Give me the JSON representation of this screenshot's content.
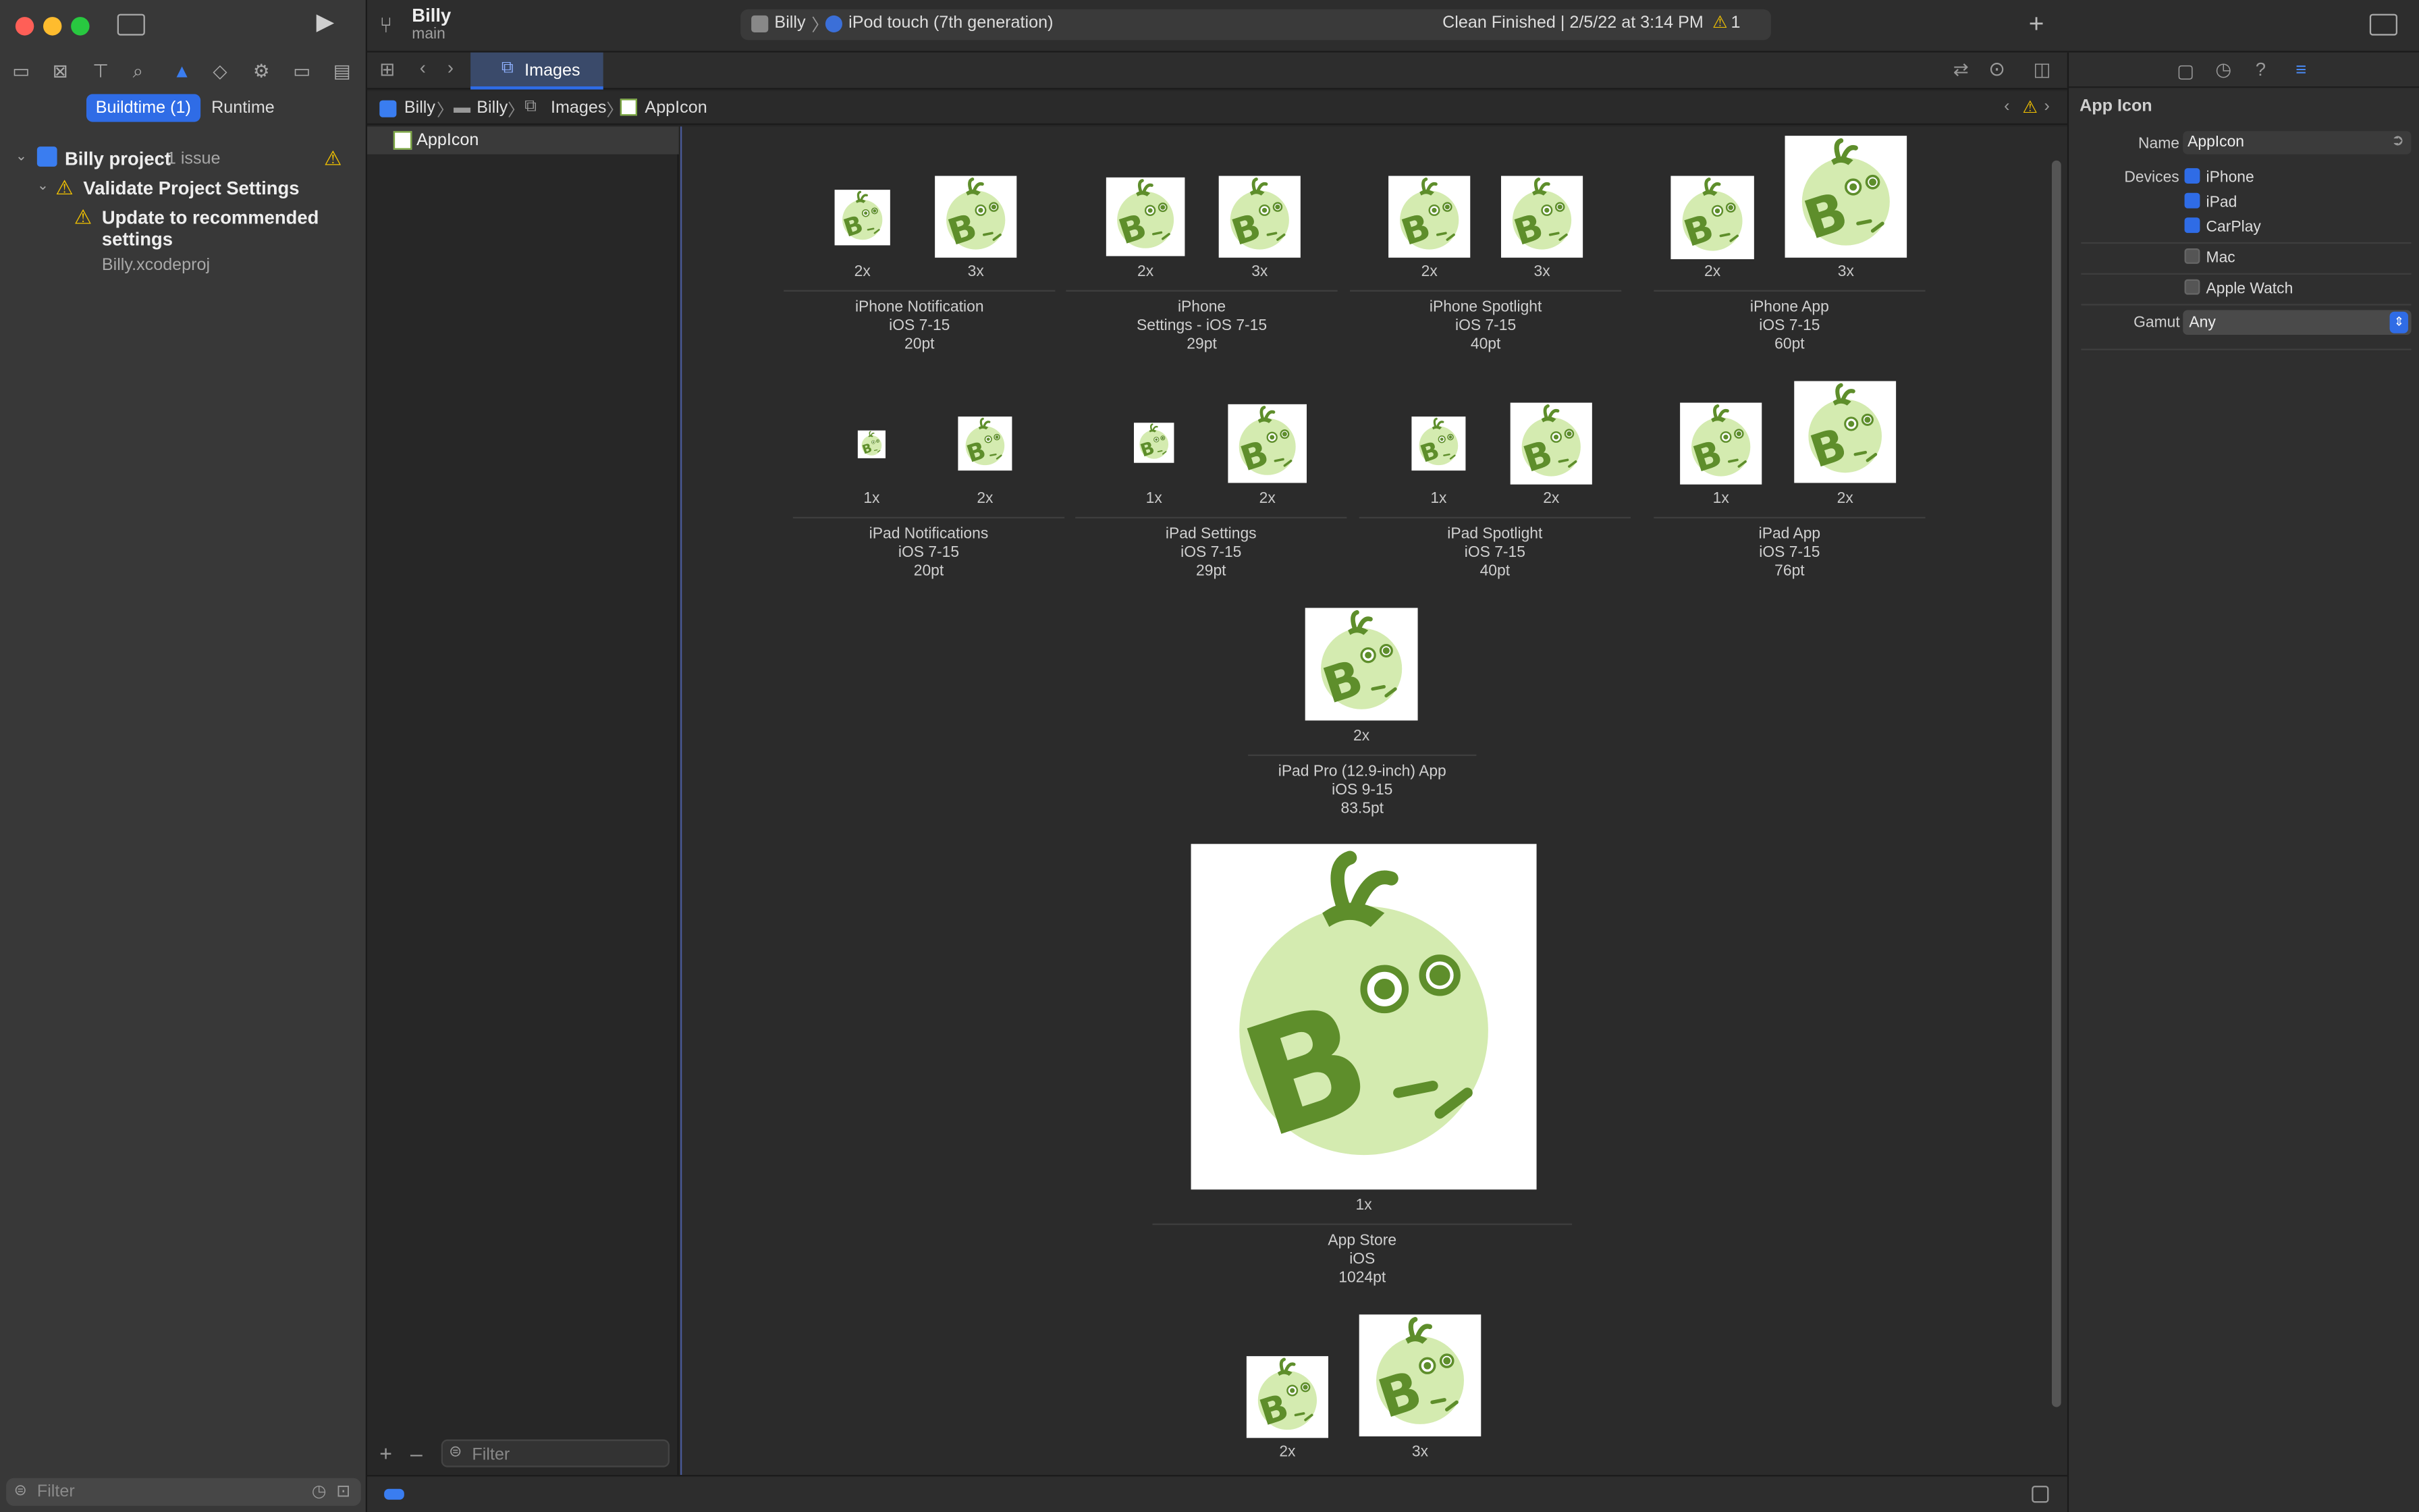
{
  "window": {
    "project_name": "Billy",
    "branch": "main",
    "scheme": "Billy",
    "device": "iPod touch (7th generation)",
    "activity_status": "Clean Finished | 2/5/22 at 3:14 PM",
    "warning_count": "1"
  },
  "navigator": {
    "segments": [
      "Buildtime (1)",
      "Runtime"
    ],
    "project_label": "Billy project",
    "issue_count": "1 issue",
    "group_label": "Validate Project Settings",
    "issue_text": "Update to recommended settings",
    "issue_file": "Billy.xcodeproj",
    "filter_placeholder": "Filter"
  },
  "tabs": {
    "active": "Images"
  },
  "jumpbar": [
    "Billy",
    "Billy",
    "Images",
    "AppIcon"
  ],
  "asset_list": {
    "items": [
      "AppIcon"
    ],
    "filter_placeholder": "Filter"
  },
  "icon_groups": [
    {
      "title": "iPhone Notification",
      "version": "iOS 7-15",
      "size": "20pt",
      "scales": [
        "2x",
        "3x"
      ]
    },
    {
      "title": "iPhone",
      "version": "Settings - iOS 7-15",
      "size": "29pt",
      "scales": [
        "2x",
        "3x"
      ]
    },
    {
      "title": "iPhone Spotlight",
      "version": "iOS 7-15",
      "size": "40pt",
      "scales": [
        "2x",
        "3x"
      ]
    },
    {
      "title": "iPhone App",
      "version": "iOS 7-15",
      "size": "60pt",
      "scales": [
        "2x",
        "3x"
      ]
    },
    {
      "title": "iPad Notifications",
      "version": "iOS 7-15",
      "size": "20pt",
      "scales": [
        "1x",
        "2x"
      ]
    },
    {
      "title": "iPad Settings",
      "version": "iOS 7-15",
      "size": "29pt",
      "scales": [
        "1x",
        "2x"
      ]
    },
    {
      "title": "iPad Spotlight",
      "version": "iOS 7-15",
      "size": "40pt",
      "scales": [
        "1x",
        "2x"
      ]
    },
    {
      "title": "iPad App",
      "version": "iOS 7-15",
      "size": "76pt",
      "scales": [
        "1x",
        "2x"
      ]
    },
    {
      "title": "iPad Pro (12.9-inch) App",
      "version": "iOS 9-15",
      "size": "83.5pt",
      "scales": [
        "2x"
      ]
    },
    {
      "title": "App Store",
      "version": "iOS",
      "size": "1024pt",
      "scales": [
        "1x"
      ]
    },
    {
      "title": "",
      "version": "",
      "size": "",
      "scales": [
        "2x",
        "3x"
      ]
    }
  ],
  "inspector": {
    "section_title": "App Icon",
    "name_label": "Name",
    "name_value": "AppIcon",
    "devices_label": "Devices",
    "devices": [
      {
        "label": "iPhone",
        "checked": true
      },
      {
        "label": "iPad",
        "checked": true
      },
      {
        "label": "CarPlay",
        "checked": true
      },
      {
        "label": "Mac",
        "checked": false
      },
      {
        "label": "Apple Watch",
        "checked": false
      }
    ],
    "gamut_label": "Gamut",
    "gamut_value": "Any"
  },
  "colors": {
    "accent": "#2f6ce6",
    "icon_dark": "#5e8e2b",
    "icon_light": "#d4ebb0",
    "warning": "#f5c400"
  }
}
